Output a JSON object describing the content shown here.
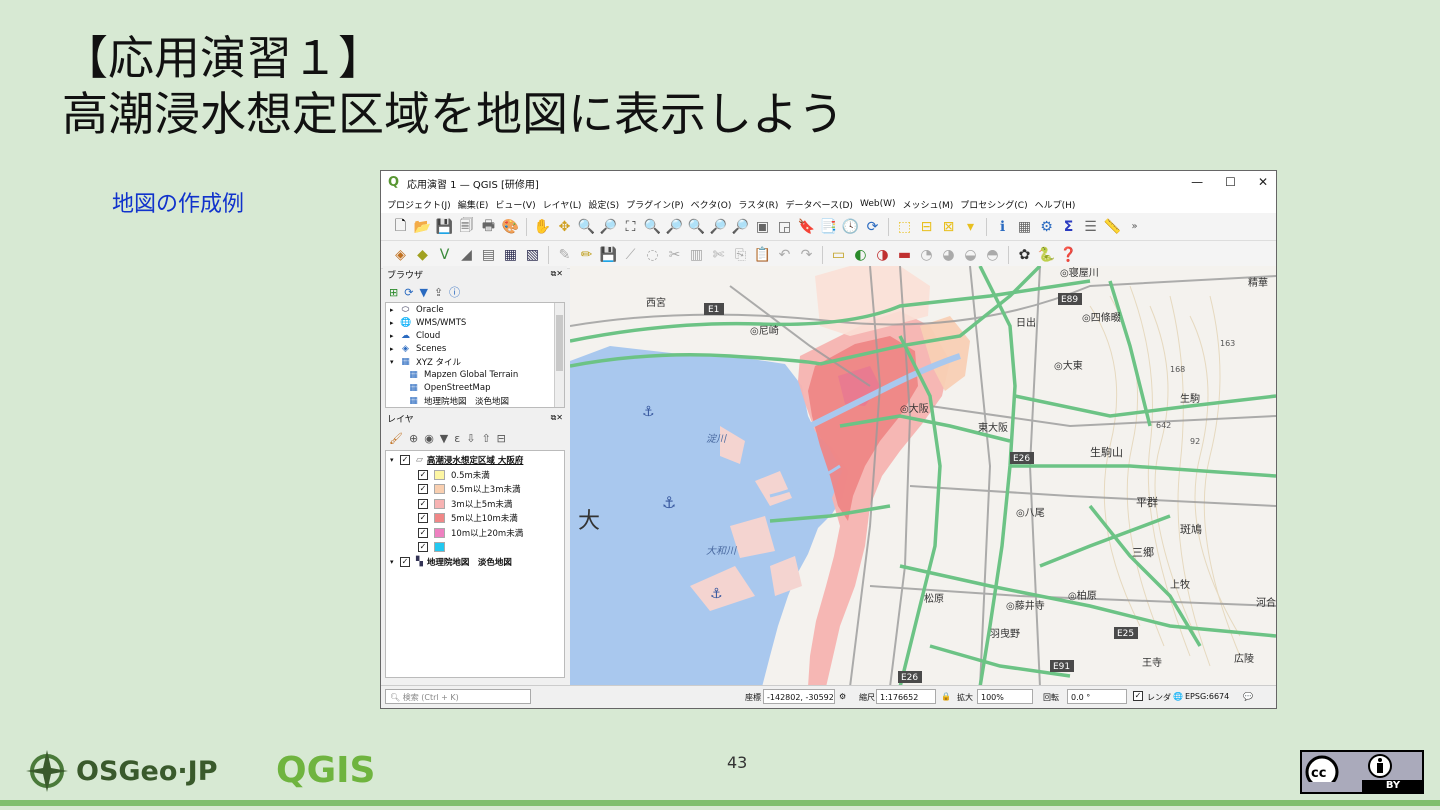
{
  "slide": {
    "title_line1": "【応用演習１】",
    "title_line2": "高潮浸水想定区域を地図に表示しよう",
    "subtitle": "地図の作成例",
    "page_number": "43",
    "logo_osgeo": "OSGeo·JP",
    "logo_qgis": "QGIS",
    "license_badge": "BY"
  },
  "window": {
    "title": "応用演習 1 — QGIS [研修用]",
    "menu": [
      "プロジェクト(J)",
      "編集(E)",
      "ビュー(V)",
      "レイヤ(L)",
      "設定(S)",
      "プラグイン(P)",
      "ベクタ(O)",
      "ラスタ(R)",
      "データベース(D)",
      "Web(W)",
      "メッシュ(M)",
      "プロセシング(C)",
      "ヘルプ(H)"
    ]
  },
  "browser": {
    "title": "ブラウザ",
    "items": [
      {
        "label": "Oracle",
        "icon": "oracle-icon"
      },
      {
        "label": "WMS/WMTS",
        "icon": "globe-icon"
      },
      {
        "label": "Cloud",
        "icon": "cloud-icon"
      },
      {
        "label": "Scenes",
        "icon": "scenes-icon"
      },
      {
        "label": "XYZ タイル",
        "icon": "grid-icon"
      },
      {
        "label": "Mapzen Global Terrain",
        "icon": "grid-icon"
      },
      {
        "label": "OpenStreetMap",
        "icon": "grid-icon"
      },
      {
        "label": "地理院地図　淡色地図",
        "icon": "grid-icon"
      }
    ]
  },
  "layers": {
    "title": "レイヤ",
    "group": "高潮浸水想定区域 大阪府",
    "classes": [
      {
        "label": "0.5m未満",
        "color": "#fdf6a3"
      },
      {
        "label": "0.5m以上3m未満",
        "color": "#f9cfb0"
      },
      {
        "label": "3m以上5m未満",
        "color": "#f7b3b3"
      },
      {
        "label": "5m以上10m未満",
        "color": "#f08787"
      },
      {
        "label": "10m以上20m未満",
        "color": "#ee80c0"
      },
      {
        "label": "",
        "color": "#22c8f0"
      }
    ],
    "basemap": "地理院地図　淡色地図"
  },
  "map_labels": {
    "road_e1": "E1",
    "road_e89": "E89",
    "road_e26": "E26",
    "road_e26b": "E26",
    "road_e25": "E25",
    "road_e91": "E91",
    "city_osaka": "◎大阪",
    "city_higashiosaka": "東大阪",
    "city_neyagawa": "◎寝屋川",
    "city_shijonawate": "◎四條畷",
    "city_daito": "◎大東",
    "city_yao": "◎八尾",
    "city_kashiwara": "◎柏原",
    "city_fujiidera": "◎藤井寺",
    "city_habikino": "羽曳野",
    "city_matsubara": "松原",
    "city_amagasaki": "◎尼崎",
    "city_nishinomiya": "西宮",
    "city_sakai": "大",
    "river_yodo": "淀川",
    "river_yamato": "大和川",
    "mountain_ikoma": "生駒山",
    "town_heguri": "平群",
    "town_ikaruga": "斑鳩",
    "town_sango": "三郷",
    "town_kanmaki": "上牧",
    "town_ouji": "王寺",
    "town_koryo": "広陵",
    "route_163": "163",
    "route_168": "168",
    "route_642": "642",
    "route_92": "92",
    "place_ikoma": "生駒",
    "place_hinode": "日出",
    "place_kawachi": "河合",
    "place_seika": "精華"
  },
  "statusbar": {
    "search_placeholder": "検索 (Ctrl + K)",
    "coord_label": "座標",
    "coord_value": "-142802, -30592",
    "scale_label": "縮尺",
    "scale_value": "1:176652",
    "zoom_label": "拡大",
    "zoom_value": "100%",
    "rotation_label": "回転",
    "rotation_value": "0.0 °",
    "render_label": "レンダ",
    "crs": "EPSG:6674"
  }
}
